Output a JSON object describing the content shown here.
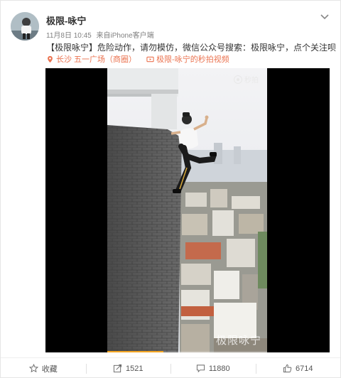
{
  "post": {
    "author": "极限-咏宁",
    "date": "11月8日 10:45",
    "source_prefix": "来自",
    "source": "iPhone客户端",
    "text": "【极限咏宁】危险动作，请勿模仿，微信公众号搜索：极限咏宁，点个关注呗",
    "location_tag": "长沙 五一广场（商圈）",
    "video_tag": "极限-咏宁的秒拍视频"
  },
  "video": {
    "logo_text": "秒拍",
    "watermark": "极限咏宁",
    "progress": 0.35
  },
  "actions": {
    "favorite_label": "收藏",
    "repost_count": "1521",
    "comment_count": "11880",
    "like_count": "6714"
  },
  "icons": {
    "menu": "chevron-down-icon",
    "location": "location-pin-icon",
    "video": "video-icon",
    "favorite": "star-icon",
    "repost": "repost-icon",
    "comment": "comment-icon",
    "like": "thumbs-up-icon"
  },
  "colors": {
    "accent": "#eb7350",
    "text": "#333333",
    "meta": "#808080"
  }
}
